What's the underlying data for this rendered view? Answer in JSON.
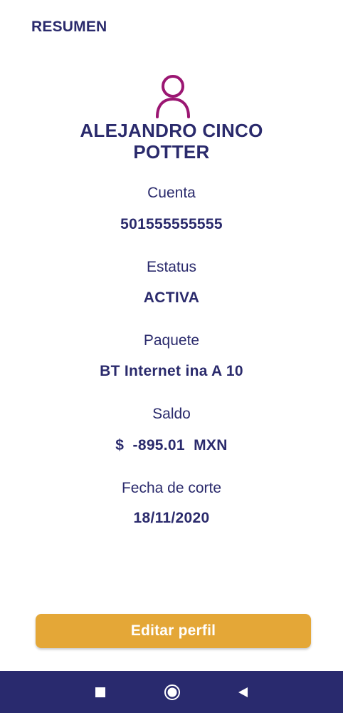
{
  "header": {
    "title": "RESUMEN"
  },
  "profile": {
    "name_line1": "ALEJANDRO CINCO",
    "name_line2": "POTTER",
    "avatar_icon": "user-outline-icon",
    "avatar_color": "#9b1672"
  },
  "fields": [
    {
      "label": "Cuenta",
      "value": "501555555555"
    },
    {
      "label": "Estatus",
      "value": "ACTIVA"
    },
    {
      "label": "Paquete",
      "value": "BT Internet ina A 10"
    },
    {
      "label": "Saldo",
      "value": "$  -895.01  MXN"
    },
    {
      "label": "Fecha de corte",
      "value": "18/11/2020"
    }
  ],
  "actions": {
    "edit_profile_label": "Editar perfil",
    "button_color": "#e4a737"
  },
  "navbar": {
    "background": "#292a6e",
    "icons": [
      "recents-square-icon",
      "home-circle-icon",
      "back-triangle-icon"
    ]
  },
  "colors": {
    "primary_text": "#2a2a6c"
  }
}
